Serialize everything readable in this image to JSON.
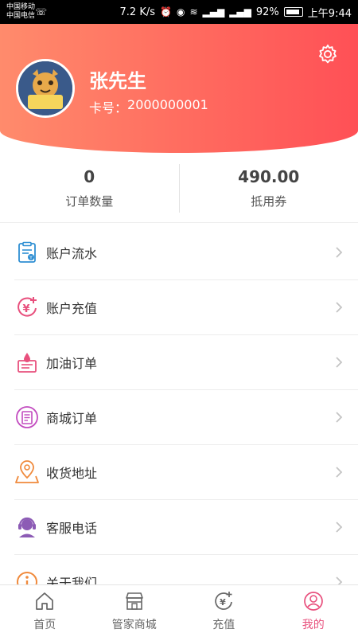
{
  "status_bar": {
    "carrier1": "中国移动",
    "carrier2": "中国电信",
    "speed": "7.2 K/s",
    "battery": "92%",
    "time": "上午9:44"
  },
  "profile": {
    "name": "张先生",
    "card_label": "卡号：",
    "card_number": "2000000001"
  },
  "stats": [
    {
      "value": "0",
      "label": "订单数量"
    },
    {
      "value": "490.00",
      "label": "抵用券"
    }
  ],
  "menu": [
    {
      "label": "账户流水",
      "icon": "account-statement-icon"
    },
    {
      "label": "账户充值",
      "icon": "recharge-yen-icon"
    },
    {
      "label": "加油订单",
      "icon": "fuel-order-icon"
    },
    {
      "label": "商城订单",
      "icon": "mall-order-icon"
    },
    {
      "label": "收货地址",
      "icon": "location-pin-icon"
    },
    {
      "label": "客服电话",
      "icon": "customer-service-icon"
    },
    {
      "label": "关于我们",
      "icon": "info-icon"
    }
  ],
  "nav": [
    {
      "label": "首页",
      "icon": "home-icon",
      "active": false
    },
    {
      "label": "管家商城",
      "icon": "store-icon",
      "active": false
    },
    {
      "label": "充值",
      "icon": "recharge-icon",
      "active": false
    },
    {
      "label": "我的",
      "icon": "profile-icon",
      "active": true
    }
  ],
  "colors": {
    "header_start": "#ff8b6c",
    "header_end": "#ff5056",
    "active_nav": "#e8507d",
    "icon_blue": "#2f8fd3",
    "icon_red": "#e8507d",
    "icon_purple": "#8c5bb5",
    "icon_orange": "#f08a3c"
  }
}
